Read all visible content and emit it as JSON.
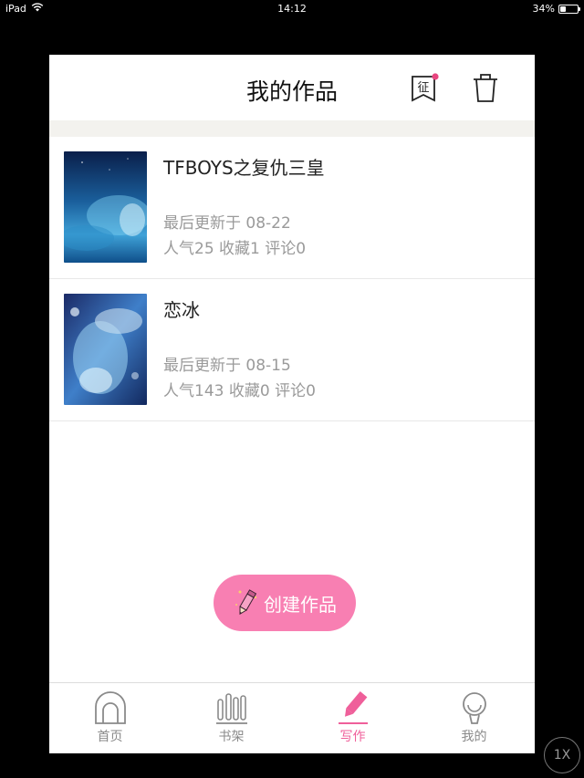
{
  "status_bar": {
    "device": "iPad",
    "time": "14:12",
    "battery": "34%",
    "battery_level": 0.34
  },
  "header": {
    "title": "我的作品",
    "contest_icon_label": "征"
  },
  "works": [
    {
      "title": "TFBOYS之复仇三皇",
      "updated": "最后更新于 08-22",
      "stats": "人气25  收藏1  评论0"
    },
    {
      "title": "恋冰",
      "updated": "最后更新于 08-15",
      "stats": "人气143  收藏0  评论0"
    }
  ],
  "create_button": {
    "label": "创建作品"
  },
  "tabbar": {
    "items": [
      {
        "label": "首页",
        "icon": "home-icon"
      },
      {
        "label": "书架",
        "icon": "bookshelf-icon"
      },
      {
        "label": "写作",
        "icon": "pencil-icon",
        "active": true
      },
      {
        "label": "我的",
        "icon": "profile-icon"
      }
    ]
  },
  "zoom_button": {
    "label": "1X"
  },
  "colors": {
    "accent": "#f87fb2",
    "active_tab": "#ef5f9a",
    "badge": "#e8457f"
  }
}
